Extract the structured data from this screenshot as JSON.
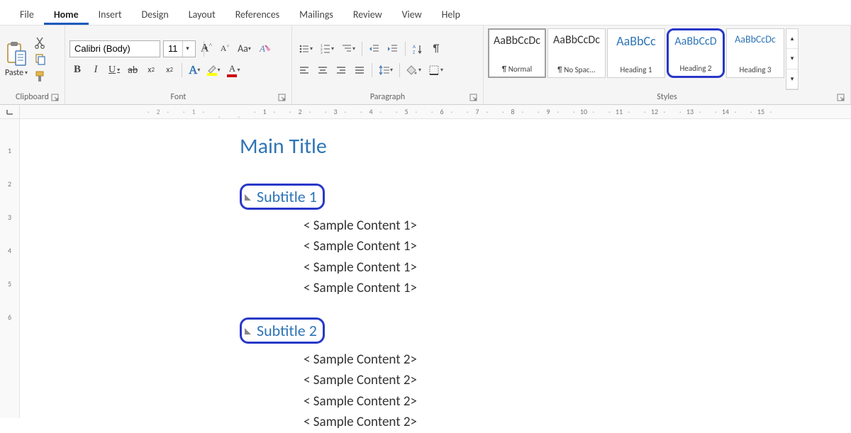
{
  "tabs": {
    "file": "File",
    "home": "Home",
    "insert": "Insert",
    "design": "Design",
    "layout": "Layout",
    "references": "References",
    "mailings": "Mailings",
    "review": "Review",
    "view": "View",
    "help": "Help"
  },
  "clipboard": {
    "paste": "Paste",
    "group_label": "Clipboard"
  },
  "font": {
    "name": "Calibri (Body)",
    "size": "11",
    "case_label": "Aa",
    "bold": "B",
    "italic": "I",
    "underline": "U",
    "strike": "ab",
    "sub": "x",
    "sup": "x",
    "effects": "A",
    "group_label": "Font"
  },
  "paragraph": {
    "group_label": "Paragraph"
  },
  "styles": {
    "group_label": "Styles",
    "tiles": [
      {
        "preview": "AaBbCcDc",
        "name": "¶ Normal"
      },
      {
        "preview": "AaBbCcDc",
        "name": "¶ No Spac..."
      },
      {
        "preview": "AaBbCc",
        "name": "Heading 1"
      },
      {
        "preview": "AaBbCcD",
        "name": "Heading 2"
      },
      {
        "preview": "AaBbCcDc",
        "name": "Heading 3"
      }
    ]
  },
  "ruler": {
    "h": [
      "2",
      "1",
      "",
      "1",
      "2",
      "3",
      "4",
      "5",
      "6",
      "7",
      "8",
      "9",
      "10",
      "11",
      "12",
      "13",
      "14",
      "15"
    ],
    "v": [
      "",
      "1",
      "2",
      "3",
      "4",
      "5",
      "6"
    ]
  },
  "document": {
    "main_title": "Main Title",
    "sections": [
      {
        "subtitle": "Subtitle 1",
        "lines": [
          "< Sample Content 1>",
          "< Sample Content 1>",
          "< Sample Content 1>",
          "< Sample Content 1>"
        ]
      },
      {
        "subtitle": "Subtitle 2",
        "lines": [
          "< Sample Content 2>",
          "< Sample Content 2>",
          "< Sample Content 2>",
          "< Sample Content 2>"
        ]
      }
    ]
  }
}
